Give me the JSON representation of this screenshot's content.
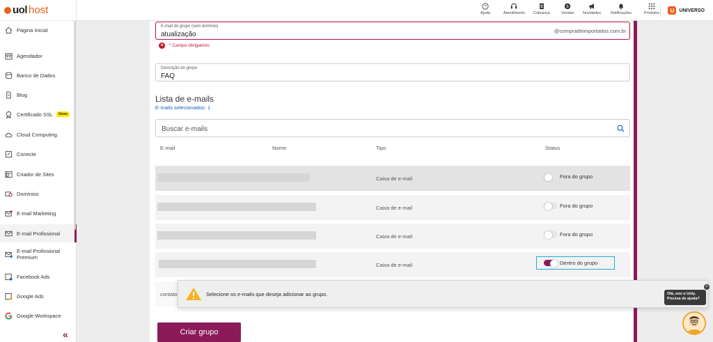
{
  "brand": {
    "uol": "uol",
    "host": "host"
  },
  "sidebar": {
    "items": [
      {
        "label": "Página Inicial",
        "icon": "home-icon"
      },
      {
        "label": "Agendador",
        "icon": "calendar-icon"
      },
      {
        "label": "Banco de Dados",
        "icon": "database-icon"
      },
      {
        "label": "Blog",
        "icon": "blog-icon"
      },
      {
        "label": "Certificado SSL",
        "icon": "certificate-icon",
        "badge": "News"
      },
      {
        "label": "Cloud Computing",
        "icon": "cloud-icon"
      },
      {
        "label": "Conecte",
        "icon": "connect-icon"
      },
      {
        "label": "Criador de Sites",
        "icon": "site-builder-icon"
      },
      {
        "label": "Domínios",
        "icon": "domain-icon"
      },
      {
        "label": "E-mail Marketing",
        "icon": "email-marketing-icon"
      },
      {
        "label": "E-mail Profissional",
        "icon": "email-icon",
        "active": true
      },
      {
        "label": "E-mail Profissional Premium",
        "icon": "email-premium-icon"
      },
      {
        "label": "Facebook Ads",
        "icon": "facebook-ads-icon"
      },
      {
        "label": "Google Ads",
        "icon": "google-ads-icon"
      },
      {
        "label": "Google Workspace",
        "icon": "google-icon"
      }
    ],
    "collapse_label": "«"
  },
  "topbar": {
    "items": [
      {
        "label": "Ajuda",
        "icon": "help-icon"
      },
      {
        "label": "Atendimento",
        "icon": "headset-icon"
      },
      {
        "label": "Cobrança",
        "icon": "invoice-icon"
      },
      {
        "label": "Vendas",
        "icon": "sales-icon"
      },
      {
        "label": "Novidades",
        "icon": "megaphone-icon"
      },
      {
        "label": "Notificações",
        "icon": "bell-icon"
      },
      {
        "label": "Produtos",
        "icon": "grid-icon"
      }
    ],
    "account": {
      "badge": "U",
      "label": "UNIVERSO"
    }
  },
  "form": {
    "email_label": "E-mail do grupo (sem domínio)",
    "email_value": "atualização",
    "email_domain": "@compradeimportados.com.br",
    "email_error": "* Campo obrigatório",
    "error_icon": "×",
    "desc_label": "Descrição do grupo",
    "desc_value": "FAQ"
  },
  "list": {
    "title": "Lista de e-mails",
    "selected": "E-mails selecionados: 1",
    "search_placeholder": "Buscar e-mails",
    "columns": {
      "email": "E-mail",
      "nome": "Nome",
      "tipo": "Tipo",
      "status": "Status"
    },
    "rows": [
      {
        "tipo": "Caixa de e-mail",
        "status": "Fora do grupo",
        "on": false
      },
      {
        "tipo": "Caixa de e-mail",
        "status": "Fora do grupo",
        "on": false
      },
      {
        "tipo": "Caixa de e-mail",
        "status": "Fora do grupo",
        "on": false
      },
      {
        "tipo": "Caixa de e-mail",
        "status": "Dentro do grupo",
        "on": true
      }
    ],
    "partial_row_text": "contato"
  },
  "toast": {
    "message": "Selecione os e-mails que deseja adicionar ao grupo.",
    "icon": "warning-icon"
  },
  "create_button": "Criar grupo",
  "chat": {
    "bubble": "Olá, sou o Uoly. Precisa de ajuda?",
    "close": "×"
  },
  "colors": {
    "primary": "#8b1a59",
    "error": "#c0152b",
    "link": "#1a62b6",
    "accent": "#e8601c"
  }
}
